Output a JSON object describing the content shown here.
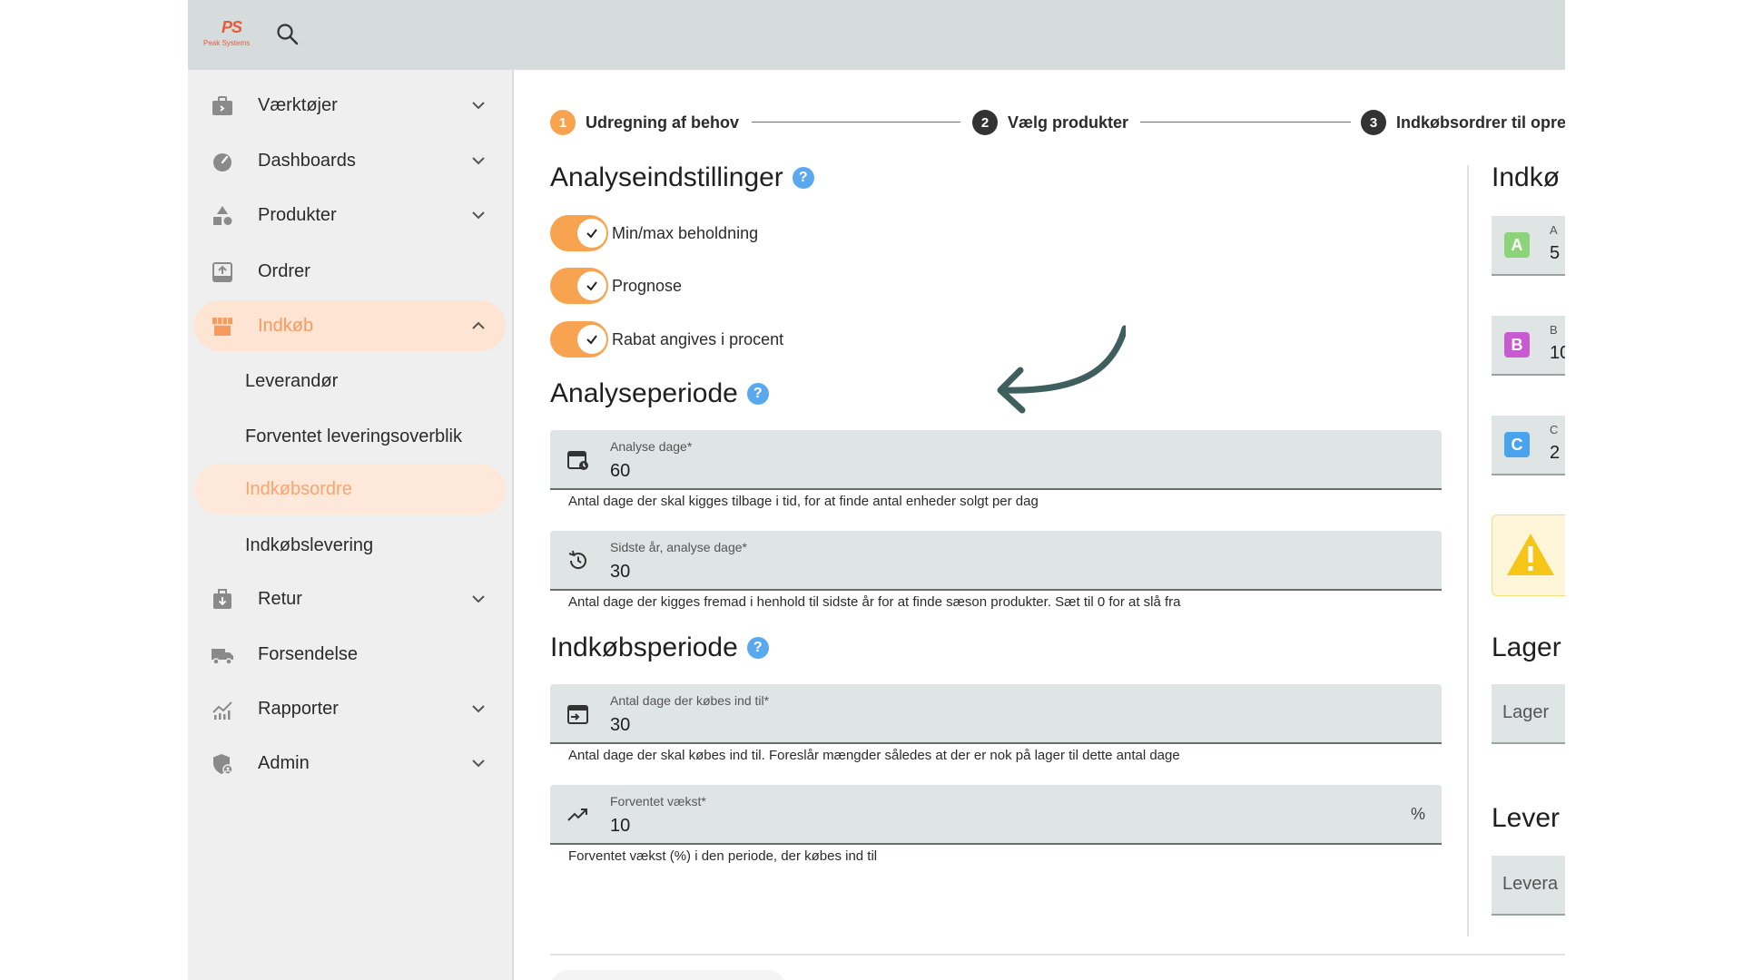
{
  "header": {
    "logo_mark": "PS",
    "logo_text": "Peak Systems",
    "search_icon": "search-icon"
  },
  "sidebar": {
    "items": [
      {
        "label": "Værktøjer",
        "icon": "briefcase-icon",
        "expandable": true
      },
      {
        "label": "Dashboards",
        "icon": "speedometer-icon",
        "expandable": true
      },
      {
        "label": "Produkter",
        "icon": "shapes-icon",
        "expandable": true
      },
      {
        "label": "Ordrer",
        "icon": "inbox-upload-icon",
        "expandable": false
      },
      {
        "label": "Indkøb",
        "icon": "store-icon",
        "expandable": true,
        "expanded": true,
        "active": true
      },
      {
        "label": "Retur",
        "icon": "return-box-icon",
        "expandable": true
      },
      {
        "label": "Forsendelse",
        "icon": "truck-icon",
        "expandable": false
      },
      {
        "label": "Rapporter",
        "icon": "chart-icon",
        "expandable": true
      },
      {
        "label": "Admin",
        "icon": "shield-user-icon",
        "expandable": true
      }
    ],
    "subitems": [
      {
        "label": "Leverandør"
      },
      {
        "label": "Forventet leveringsoverblik"
      },
      {
        "label": "Indkøbsordre",
        "active": true
      },
      {
        "label": "Indkøbslevering"
      }
    ]
  },
  "stepper": {
    "steps": [
      {
        "number": "1",
        "label": "Udregning af behov",
        "active": true
      },
      {
        "number": "2",
        "label": "Vælg produkter",
        "active": false
      },
      {
        "number": "3",
        "label": "Indkøbsordrer til opre",
        "active": false
      }
    ]
  },
  "analysis_settings": {
    "title": "Analyseindstillinger",
    "help": "?",
    "toggles": [
      {
        "label": "Min/max beholdning",
        "checked": true
      },
      {
        "label": "Prognose",
        "checked": true
      },
      {
        "label": "Rabat angives i procent",
        "checked": true
      }
    ]
  },
  "analysis_period": {
    "title": "Analyseperiode",
    "help": "?",
    "fields": [
      {
        "label": "Analyse dage*",
        "value": "60",
        "hint": "Antal dage der skal kigges tilbage i tid, for at finde antal enheder solgt per dag",
        "icon": "calendar-clock-icon"
      },
      {
        "label": "Sidste år, analyse dage*",
        "value": "30",
        "hint": "Antal dage der kigges fremad i henhold til sidste år for at finde sæson produkter. Sæt til 0 for at slå fra",
        "icon": "history-icon"
      }
    ]
  },
  "purchase_period": {
    "title": "Indkøbsperiode",
    "help": "?",
    "fields": [
      {
        "label": "Antal dage der købes ind til*",
        "value": "30",
        "hint": "Antal dage der skal købes ind til. Foreslår mængder således at der er nok på lager til dette antal dage",
        "icon": "calendar-arrow-icon"
      },
      {
        "label": "Forventet vækst*",
        "value": "10",
        "suffix": "%",
        "hint": "Forventet vækst (%) i den periode, der købes ind til",
        "icon": "trending-up-icon"
      }
    ]
  },
  "right_panel": {
    "title": "Indkø",
    "badges": [
      {
        "letter": "A",
        "label": "A",
        "value": "5",
        "color": "#8bd47a"
      },
      {
        "letter": "B",
        "label": "B",
        "value": "10",
        "color": "#c95bd0"
      },
      {
        "letter": "C",
        "label": "C",
        "value": "2",
        "color": "#4aa3ee"
      }
    ],
    "warning_icon": "warning-icon",
    "lager_title": "Lager",
    "lager_placeholder": "Lager",
    "lever_title": "Lever",
    "lever_placeholder": "Levera"
  },
  "colors": {
    "accent": "#f7a350",
    "active_bg": "#fde4d3",
    "help": "#5aa8ee",
    "arrow": "#3f5f5e",
    "step_dark": "#333333"
  }
}
